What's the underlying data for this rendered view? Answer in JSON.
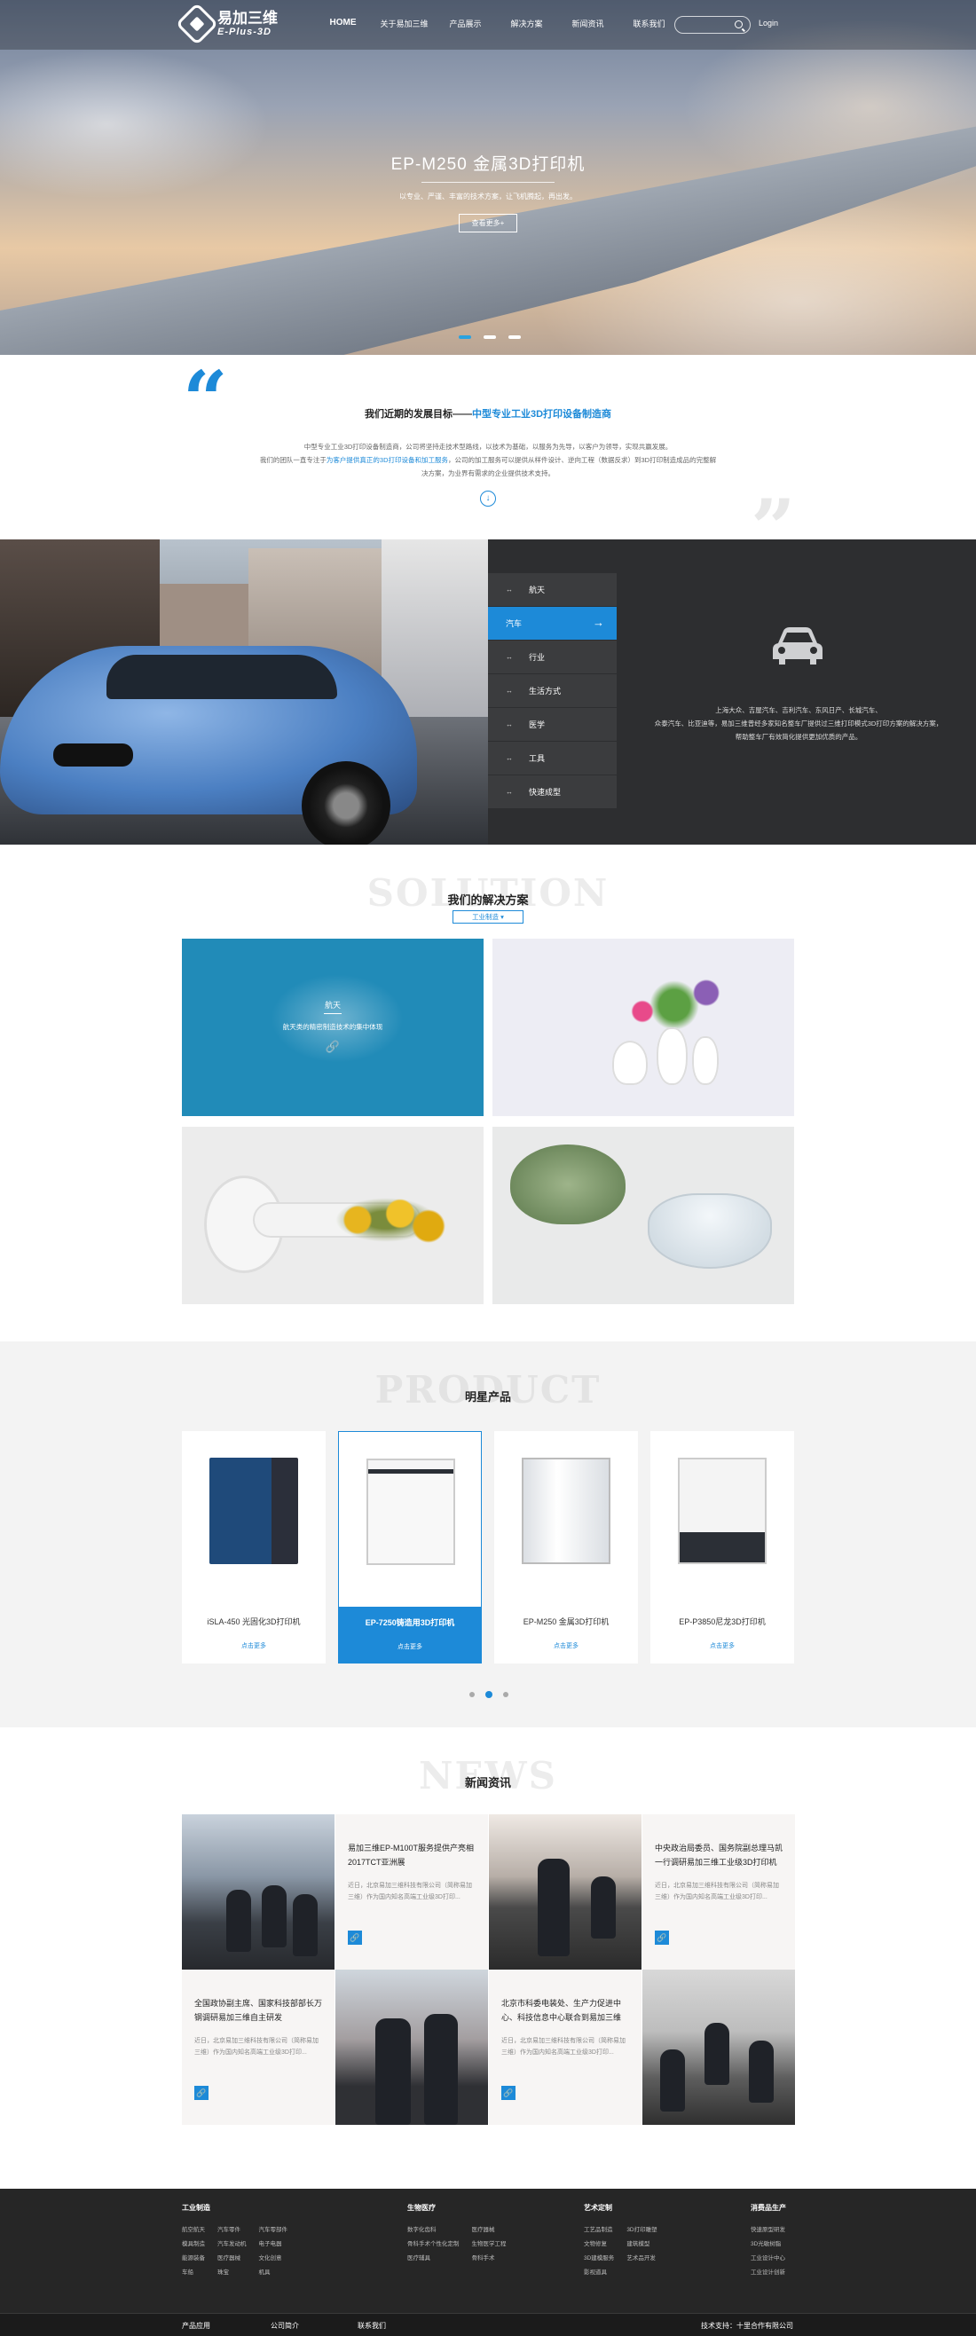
{
  "header": {
    "logo_cn": "易加三维",
    "logo_en": "E-Plus-3D",
    "nav": [
      {
        "label": "HOME",
        "active": true
      },
      {
        "label": "关于易加三维"
      },
      {
        "label": "产品展示"
      },
      {
        "label": "解决方案"
      },
      {
        "label": "新闻资讯"
      },
      {
        "label": "联系我们"
      }
    ],
    "login_label": "Login",
    "search_placeholder": ""
  },
  "hero": {
    "title": "EP-M250 金属3D打印机",
    "subtitle": "以专业、严谨、丰富的技术方案，让飞机腾起，再出发。",
    "button": "查看更多+",
    "slides": 3,
    "active_slide": 1
  },
  "goal": {
    "title_prefix": "我们近期的发展目标——",
    "title_highlight": "中型专业工业3D打印设备制造商",
    "body_line1": "中型专业工业3D打印设备制造商，公司将坚持走技术型路线，以技术为基础，以服务为先导，以客户为领导，实现共赢发展。",
    "body_line2_prefix": "我们的团队一直专注于",
    "body_line2_highlight": "为客户提供真正的3D打印设备和加工服务",
    "body_line2_suffix": "，公司的加工服务可以提供从样件设计、逆向工程（数据反求）到3D打印制造成品的完整解",
    "body_line3": "决方案，为业界有需求的企业提供技术支持。"
  },
  "industry": {
    "menu": [
      {
        "label": "航天"
      },
      {
        "label": "汽车",
        "active": true
      },
      {
        "label": "行业"
      },
      {
        "label": "生活方式"
      },
      {
        "label": "医学"
      },
      {
        "label": "工具"
      },
      {
        "label": "快速成型"
      }
    ],
    "text_line1": "上海大众、吉屋汽车、吉利汽车、东风日产、长城汽车、",
    "text_line2": "众泰汽车、比亚迪等，易加三维曾经多家知名整车厂提供过三维打印模式3D打印方案的解决方案，",
    "text_line3": "帮助整车厂有效简化提供更加优质的产品。"
  },
  "solution": {
    "bg_word": "SOLUTION",
    "title": "我们的解决方案",
    "select_value": "工业制造",
    "card1_title": "航天",
    "card1_desc": "航天类的精密制造技术的集中体现"
  },
  "product": {
    "bg_word": "PRODUCT",
    "title": "明星产品",
    "items": [
      {
        "name": "iSLA-450 光固化3D打印机",
        "more": "点击更多"
      },
      {
        "name": "EP-7250铸造用3D打印机",
        "more": "点击更多",
        "active": true
      },
      {
        "name": "EP-M250 金属3D打印机",
        "more": "点击更多"
      },
      {
        "name": "EP-P3850尼龙3D打印机",
        "more": "点击更多"
      }
    ],
    "pages": 3,
    "active_page": 1
  },
  "news": {
    "bg_word": "NEWS",
    "title": "新闻资讯",
    "items": [
      {
        "title": "易加三维EP-M100T服务提供产亮相2017TCT亚洲展",
        "desc": ""
      },
      {
        "title": "中央政治局委员、国务院副总理马凯一行调研易加三维工业级3D打印机",
        "desc": "近日，北京易加三维科技有限公司（简称易加三维）作为国内知名高端工业级3D打印..."
      },
      {
        "title": "全国政协副主席、国家科技部部长万钢调研易加三维自主研发",
        "desc": "近日，北京易加三维科技有限公司（简称易加三维）作为国内知名高端工业级3D打印..."
      },
      {
        "title": "北京市科委电装处、生产力促进中心、科技信息中心联合到易加三维",
        "desc": "近日，北京易加三维科技有限公司（简称易加三维）作为国内知名高端工业级3D打印..."
      }
    ],
    "item0_desc": "近日，北京易加三维科技有限公司（简称易加三维）作为国内知名高端工业级3D打印..."
  },
  "footer": {
    "col1": {
      "title": "工业制造",
      "items": [
        "航空航天",
        "模具制造",
        "能源装备",
        "车船",
        "汽车零件",
        "汽车发动机",
        "医疗器械",
        "珠宝",
        "汽车零部件",
        "电子电器",
        "文化创意",
        "机具"
      ]
    },
    "col2": {
      "title": "生物医疗",
      "items": [
        "数字化齿科",
        "骨科手术个性化定制",
        "医疗辅具",
        "医疗器械",
        "生物医学工程",
        "骨科手术"
      ]
    },
    "col3": {
      "title": "艺术定制",
      "items": [
        "工艺品制造",
        "文物修复",
        "3D建模服务",
        "影视道具",
        "3D打印雕塑",
        "建筑模型",
        "艺术品开发"
      ]
    },
    "col4": {
      "title": "消费品生产",
      "items": [
        "快速原型研发",
        "3D光敏树脂",
        "工业设计中心",
        "工业设计创新"
      ]
    },
    "bar_links": [
      "产品应用",
      "公司简介",
      "联系我们"
    ],
    "support": "技术支持：十里合作有限公司"
  }
}
